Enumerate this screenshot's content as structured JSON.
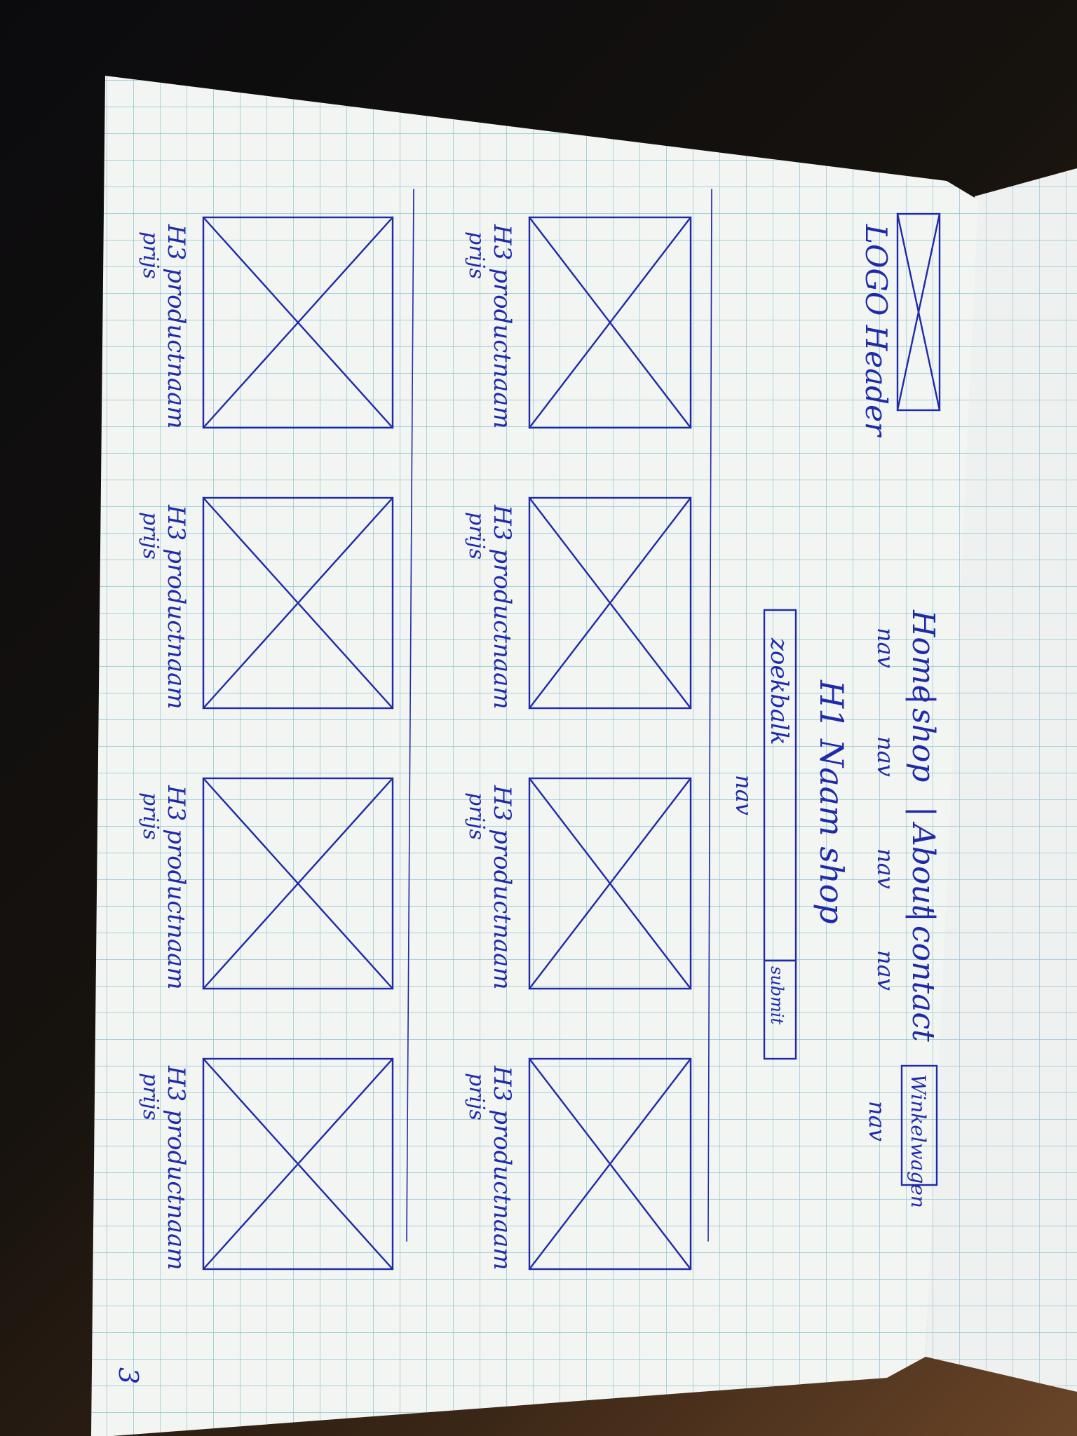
{
  "header": {
    "logo_label": "LOGO Header",
    "nav_links": [
      "Home",
      "shop",
      "About",
      "contact"
    ],
    "nav_separator": "|",
    "cart_label": "Winkelwagen",
    "nav_annotation": "nav"
  },
  "hero": {
    "title": "H1 Naam shop",
    "search_placeholder": "zoekbalk",
    "submit_label": "submit",
    "search_annotation": "nav"
  },
  "products": {
    "heading_label": "H3 productnaam",
    "price_label": "prijs",
    "count": 8
  },
  "page_number": "3"
}
